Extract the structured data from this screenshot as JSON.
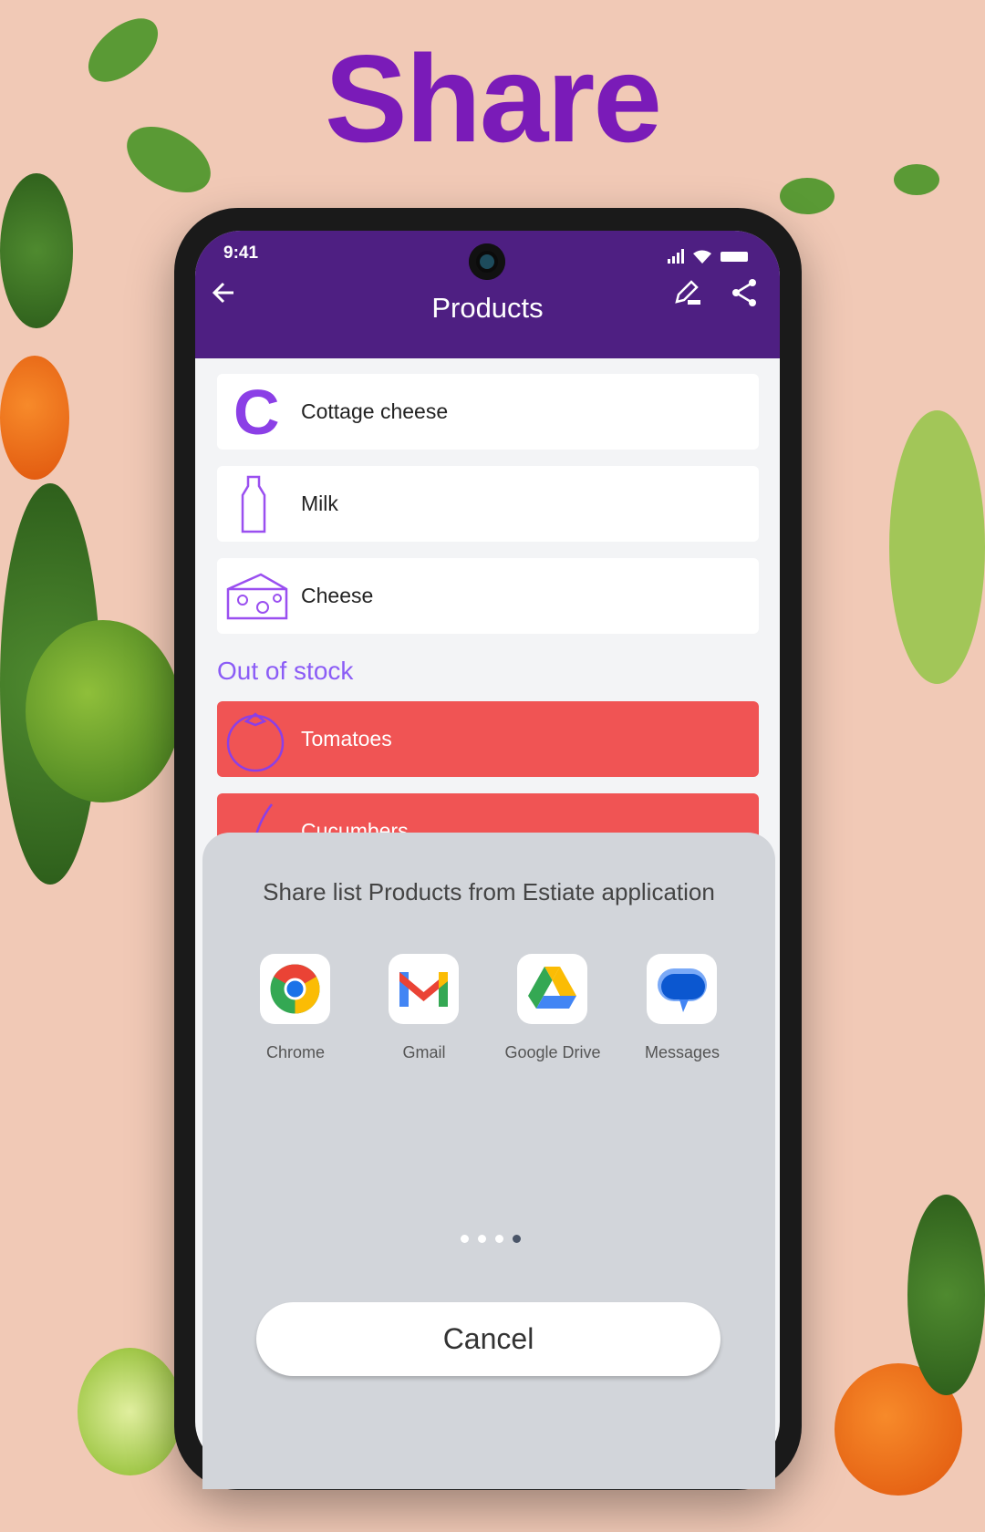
{
  "headline": "Share",
  "status_bar": {
    "time": "9:41"
  },
  "app_bar": {
    "title": "Products",
    "back_icon": "arrow-left-icon",
    "edit_icon": "edit-icon",
    "share_icon": "share-icon"
  },
  "products": [
    {
      "name": "Cottage cheese",
      "icon": "letter-c-icon",
      "letter": "C"
    },
    {
      "name": "Milk",
      "icon": "milk-bottle-icon"
    },
    {
      "name": "Cheese",
      "icon": "cheese-icon"
    }
  ],
  "out_of_stock": {
    "label": "Out of stock",
    "items": [
      {
        "name": "Tomatoes",
        "icon": "tomato-icon"
      },
      {
        "name": "Cucumbers",
        "icon": "cucumber-icon"
      }
    ]
  },
  "share_sheet": {
    "title": "Share list Products from Estiate application",
    "apps": [
      {
        "label": "Chrome"
      },
      {
        "label": "Gmail"
      },
      {
        "label": "Google Drive"
      },
      {
        "label": "Messages"
      }
    ],
    "pages": 4,
    "current_page": 4,
    "cancel": "Cancel"
  },
  "colors": {
    "headline": "#7a1bb8",
    "app_bar": "#4e1f82",
    "accent": "#8b5cf6",
    "out_of_stock": "#f05454",
    "sheet": "#d2d5da"
  }
}
